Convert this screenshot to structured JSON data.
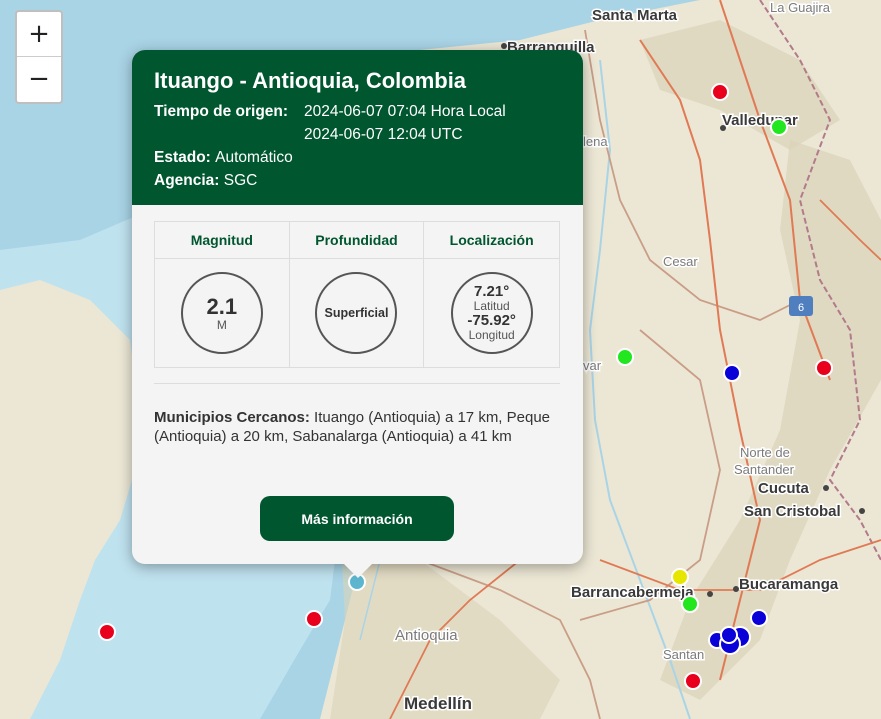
{
  "zoom": {
    "in_label": "+",
    "out_label": "−"
  },
  "map_labels": {
    "santa_marta": "Santa Marta",
    "la_guajira": "La Guajira",
    "barranquilla": "Barranquilla",
    "valledupar": "Valledupar",
    "cesar": "Cesar",
    "route_6": "6",
    "bolivar_frag": "var",
    "magdalena_frag": "lena",
    "norte_de_santander": [
      "Norte de",
      "Santander"
    ],
    "cucuta": "Cucuta",
    "san_cristobal": "San Cristobal",
    "barrancabermeja": "Barrancabermeja",
    "bucaramanga": "Bucaramanga",
    "santander_frag": "Santan",
    "antioquia": "Antioquia",
    "medellin": "Medellín"
  },
  "colors": {
    "brand": "#00562f",
    "quake_red": "#e8001c",
    "quake_green": "#22e61e",
    "quake_blue": "#0a00d8",
    "quake_yellow": "#e6e600",
    "selected": "#5db6cf"
  },
  "popup": {
    "title": "Ituango - Antioquia, Colombia",
    "origin_time_label": "Tiempo de origen:",
    "local_time": "2024-06-07 07:04 Hora Local",
    "utc_time": "2024-06-07 12:04 UTC",
    "status_label": "Estado:",
    "status_value": "Automático",
    "agency_label": "Agencia:",
    "agency_value": "SGC",
    "headers": {
      "magnitude": "Magnitud",
      "depth": "Profundidad",
      "location": "Localización"
    },
    "magnitude": "2.1",
    "magnitude_unit": "M",
    "depth": "Superficial",
    "latitude": "7.21°",
    "latitude_label": "Latitud",
    "longitude": "-75.92°",
    "longitude_label": "Longitud",
    "nearby_label": "Municipios Cercanos:",
    "nearby_value": "Ituango (Antioquia) a 17 km, Peque (Antioquia) a 20 km, Sabanalarga (Antioquia) a 41 km",
    "more_info_button": "Más información"
  }
}
